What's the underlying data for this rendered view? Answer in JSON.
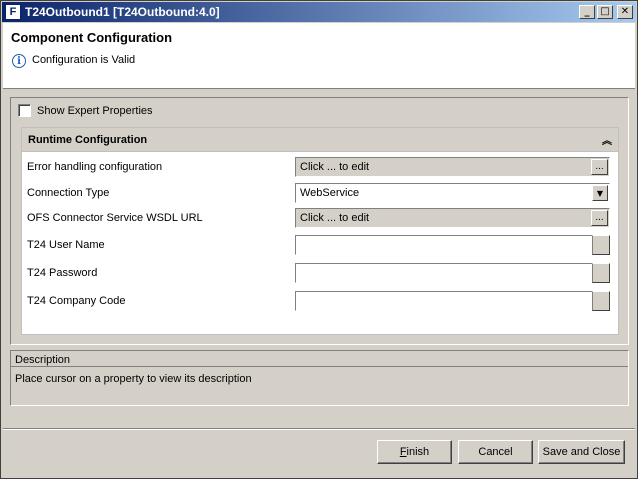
{
  "window": {
    "title": "T24Outbound1 [T24Outbound:4.0]",
    "app_icon_letter": "F"
  },
  "header": {
    "title": "Component Configuration",
    "message": "Configuration is Valid",
    "info_icon_glyph": "i"
  },
  "options": {
    "show_expert_label": "Show Expert Properties",
    "show_expert_checked": false
  },
  "section": {
    "title": "Runtime Configuration",
    "collapse_icon": "chevron-double-up-icon"
  },
  "properties": [
    {
      "label": "Error handling configuration",
      "value": "Click ... to edit",
      "editor": "ellipsis"
    },
    {
      "label": "Connection Type",
      "value": "WebService",
      "editor": "dropdown"
    },
    {
      "label": "OFS Connector Service WSDL URL",
      "value": "Click ... to edit",
      "editor": "ellipsis"
    },
    {
      "label": "T24 User Name",
      "value": "",
      "editor": "text"
    },
    {
      "label": "T24 Password",
      "value": "",
      "editor": "text"
    },
    {
      "label": "T24 Company Code",
      "value": "",
      "editor": "text"
    }
  ],
  "description": {
    "title": "Description",
    "text": "Place cursor on a property to view its description"
  },
  "buttons": {
    "finish": "Finish",
    "cancel": "Cancel",
    "save_close": "Save and Close"
  }
}
